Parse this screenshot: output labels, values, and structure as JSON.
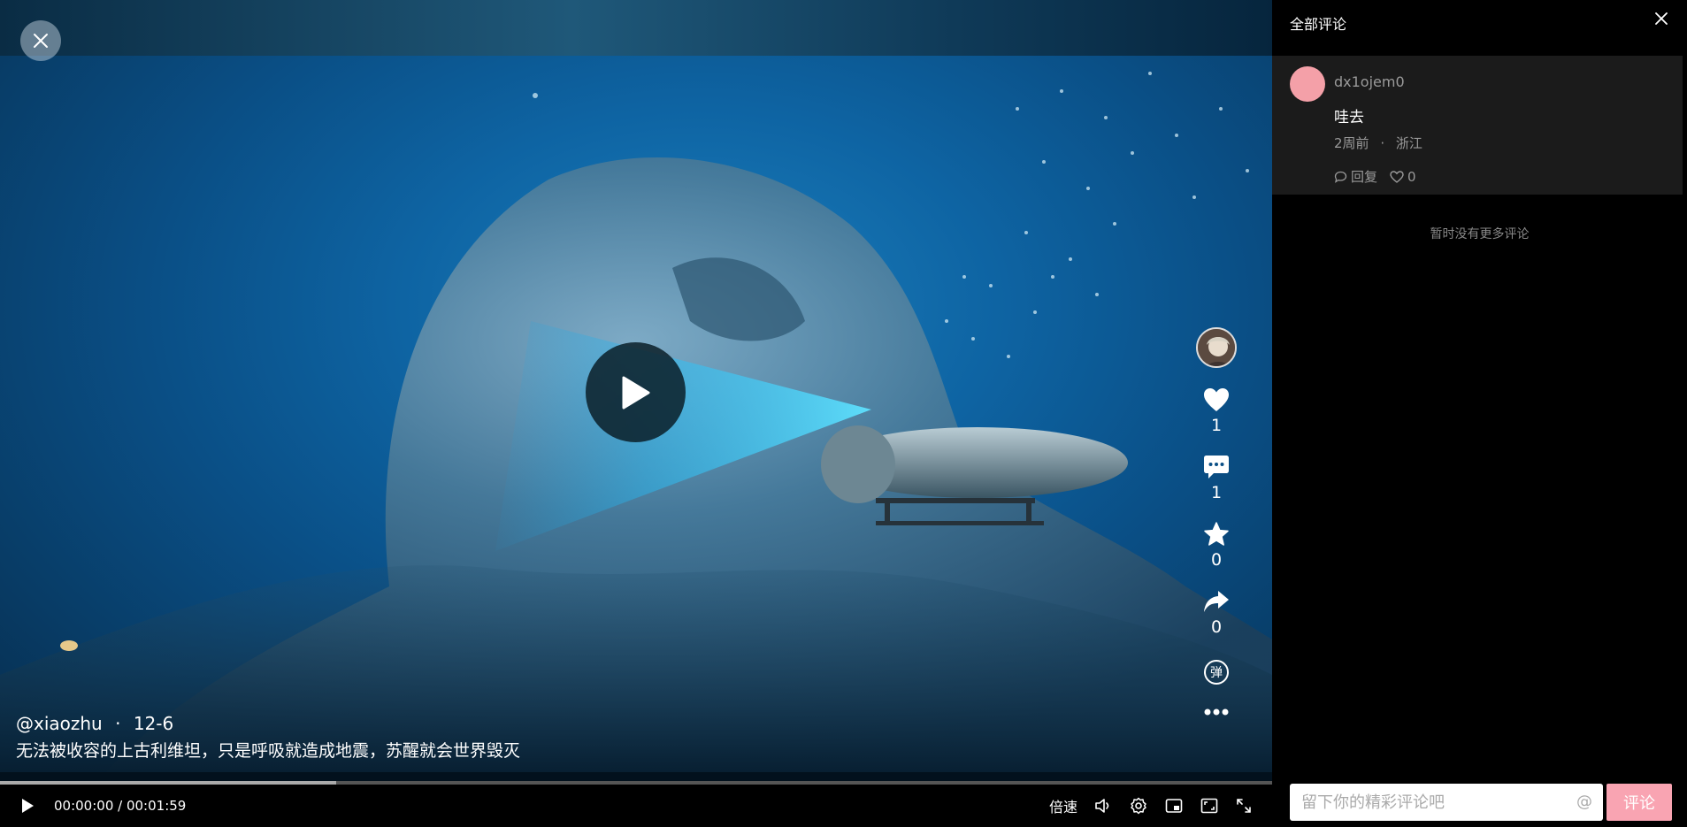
{
  "video": {
    "author": "@xiaozhu",
    "separator": "·",
    "date": "12-6",
    "description": "无法被收容的上古利维坦，只是呼吸就造成地震，苏醒就会世界毁灭",
    "likes": "1",
    "comments": "1",
    "favorites": "0",
    "shares": "0",
    "danmaku_label": "弹"
  },
  "player": {
    "current_time": "00:00:00",
    "time_separator": " / ",
    "duration": "00:01:59",
    "speed_label": "倍速",
    "buffered_fraction": 0.264
  },
  "comments_panel": {
    "title": "全部评论",
    "items": [
      {
        "user": "dx1ojem0",
        "text": "哇去",
        "time": "2周前",
        "dot": "·",
        "location": "浙江",
        "reply_label": "回复",
        "likes": "0"
      }
    ],
    "no_more_text": "暂时没有更多评论",
    "input_placeholder": "留下你的精彩评论吧",
    "at_symbol": "@",
    "submit_label": "评论"
  },
  "icons": {
    "close": "close-icon",
    "play": "play-icon",
    "like": "heart-icon",
    "comment": "comment-icon",
    "favorite": "star-icon",
    "share": "share-icon",
    "danmaku": "danmaku-icon",
    "more": "more-icon",
    "volume": "volume-icon",
    "settings": "gear-icon",
    "pip": "picture-in-picture-icon",
    "webfull": "web-fullscreen-icon",
    "fullscreen": "fullscreen-icon"
  },
  "colors": {
    "accent": "#f9a4b2",
    "panel_bg": "#000000",
    "comment_bg": "#1b1b1b",
    "avatar_pink": "#f4a0a8"
  }
}
